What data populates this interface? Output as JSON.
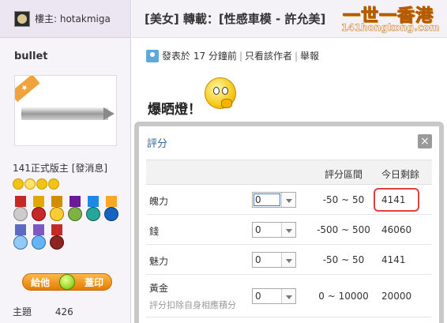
{
  "sidebar": {
    "author_label": "樓主: hotakmiga",
    "username": "bullet",
    "rank_text": "141正式版主",
    "send_message": "[發消息]",
    "give_button_left": "給他",
    "give_button_right": "蓋印",
    "stats": [
      {
        "label": "主題",
        "value": "426"
      }
    ]
  },
  "thread": {
    "title": "[美女] 轉載：[性感車模 - 許允美]",
    "site_logo_text": "一世一香港",
    "site_logo_url": "141hongkong.com"
  },
  "post": {
    "posted_prefix": "發表於",
    "posted_time": "17 分鐘前",
    "view_author": "只看該作者",
    "report": "舉報",
    "body_text": "爆晒燈！"
  },
  "rating_dialog": {
    "title": "評分",
    "close_label": "×",
    "headers": {
      "range": "評分區間",
      "remaining": "今日剩餘"
    },
    "rows": [
      {
        "name": "魄力",
        "selected": "0",
        "range": "-50 ~ 50",
        "remaining": "4141",
        "highlighted": true
      },
      {
        "name": "錢",
        "selected": "0",
        "range": "-500 ~ 500",
        "remaining": "46060"
      },
      {
        "name": "魅力",
        "selected": "0",
        "range": "-50 ~ 50",
        "remaining": "4141"
      },
      {
        "name": "黃金",
        "sub": "評分扣除自身相應積分",
        "selected": "0",
        "range": "0 ~ 10000",
        "remaining": "20000"
      }
    ]
  },
  "colors": {
    "sidebar_bg": "#f6f3f9",
    "link_blue": "#336699",
    "highlight_red": "#e04040",
    "button_orange": "#e27b00"
  }
}
